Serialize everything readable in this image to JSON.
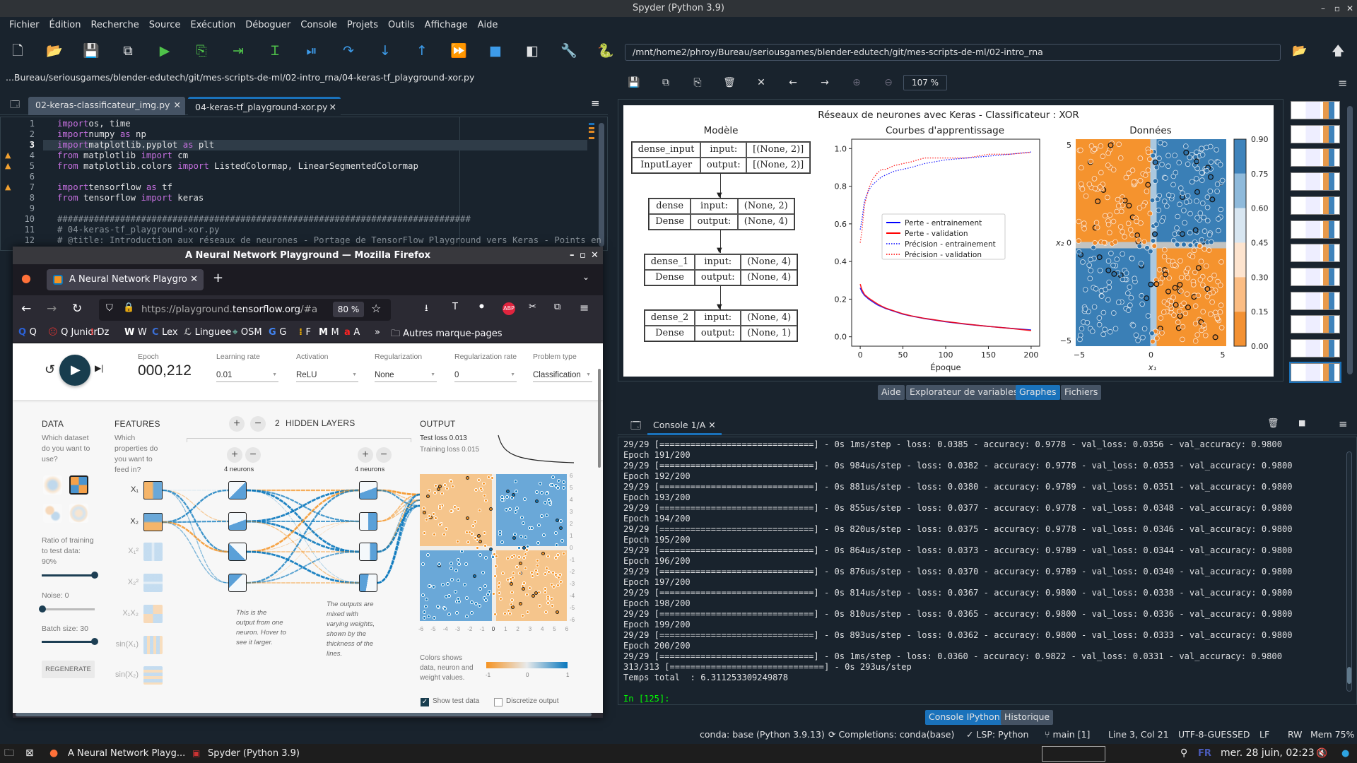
{
  "window": {
    "title": "Spyder (Python 3.9)"
  },
  "menu": [
    "Fichier",
    "Édition",
    "Recherche",
    "Source",
    "Exécution",
    "Déboguer",
    "Console",
    "Projets",
    "Outils",
    "Affichage",
    "Aide"
  ],
  "toolbar": {
    "icons": [
      "new-file-icon",
      "open-folder-icon",
      "save-icon",
      "save-all-icon",
      "run-icon",
      "run-cell-icon",
      "run-cell-advance-icon",
      "run-selection-icon",
      "debug-icon",
      "step-over-icon",
      "step-into-icon",
      "step-out-icon",
      "continue-icon",
      "stop-icon",
      "maximize-pane-icon",
      "preferences-wrench-icon",
      "python-path-icon"
    ],
    "path": "/mnt/home2/phroy/Bureau/seriousgames/blender-edutech/git/mes-scripts-de-ml/02-intro_rna"
  },
  "editor": {
    "breadcrumb": "...Bureau/seriousgames/blender-edutech/git/mes-scripts-de-ml/02-intro_rna/04-keras-tf_playground-xor.py",
    "tabs": [
      {
        "label": "02-keras-classificateur_img.py",
        "active": false
      },
      {
        "label": "04-keras-tf_playground-xor.py",
        "active": true
      }
    ],
    "current_line": 3,
    "warnings": [
      4,
      5,
      7
    ],
    "lines": [
      [
        [
          "kw",
          "import"
        ],
        [
          "",
          "os, time"
        ]
      ],
      [
        [
          "kw",
          "import"
        ],
        [
          "",
          "numpy "
        ],
        [
          "kw",
          "as"
        ],
        [
          "",
          " np"
        ]
      ],
      [
        [
          "kw",
          "import"
        ],
        [
          "",
          "matplotlib.pyplot "
        ],
        [
          "kw",
          "as"
        ],
        [
          "",
          " plt"
        ]
      ],
      [
        [
          "kw",
          "from"
        ],
        [
          "",
          " matplotlib "
        ],
        [
          "kw",
          "import"
        ],
        [
          "",
          " cm"
        ]
      ],
      [
        [
          "kw",
          "from"
        ],
        [
          "",
          " matplotlib.colors "
        ],
        [
          "kw",
          "import"
        ],
        [
          "",
          " ListedColormap, LinearSegmentedColormap"
        ]
      ],
      [],
      [
        [
          "kw",
          "import"
        ],
        [
          "",
          "tensorflow "
        ],
        [
          "kw",
          "as"
        ],
        [
          "",
          " tf"
        ]
      ],
      [
        [
          "kw",
          "from"
        ],
        [
          "",
          " tensorflow "
        ],
        [
          "kw",
          "import"
        ],
        [
          "",
          " keras"
        ]
      ],
      [],
      [
        [
          "cm",
          "###############################################################################"
        ]
      ],
      [
        [
          "cm",
          "# 04-keras-tf_playground-xor.py"
        ]
      ],
      [
        [
          "cm",
          "# @title: Introduction aux réseaux de neurones - Portage de TensorFlow Playground vers Keras - Points en"
        ]
      ]
    ]
  },
  "firefox": {
    "title": "A Neural Network Playground — Mozilla Firefox",
    "tab": "A Neural Network Playgro",
    "url_prefix": "https://playground.",
    "url_domain": "tensorflow.org",
    "url_suffix": "/#a",
    "zoom": "80 %",
    "bookmarks": [
      "Q",
      "Q Junior",
      "Dz",
      "W",
      "Lex",
      "Linguee",
      "OSM",
      "G",
      "F",
      "M",
      "A"
    ],
    "other_bookmarks": "Autres marque-pages"
  },
  "playground": {
    "epoch_label": "Epoch",
    "epoch": "000,212",
    "params": [
      {
        "label": "Learning rate",
        "value": "0.01"
      },
      {
        "label": "Activation",
        "value": "ReLU"
      },
      {
        "label": "Regularization",
        "value": "None"
      },
      {
        "label": "Regularization rate",
        "value": "0"
      },
      {
        "label": "Problem type",
        "value": "Classification"
      }
    ],
    "data": {
      "title": "DATA",
      "question": "Which dataset do you want to use?",
      "selected_dataset": "xor",
      "ratio": "Ratio of training to test data:  90%",
      "ratio_value": 90,
      "noise": "Noise:  0",
      "noise_value": 0,
      "batch": "Batch size:  30",
      "batch_value": 30,
      "regenerate": "REGENERATE"
    },
    "features": {
      "title": "FEATURES",
      "question": "Which properties do you want to feed in?",
      "items": [
        {
          "label": "X₁",
          "active": true
        },
        {
          "label": "X₂",
          "active": true
        },
        {
          "label": "X₁²",
          "active": false
        },
        {
          "label": "X₂²",
          "active": false
        },
        {
          "label": "X₁X₂",
          "active": false
        },
        {
          "label": "sin(X₁)",
          "active": false
        },
        {
          "label": "sin(X₂)",
          "active": false
        }
      ]
    },
    "hidden": {
      "count": "2",
      "label": "HIDDEN LAYERS",
      "layers": [
        {
          "neurons": "4 neurons"
        },
        {
          "neurons": "4 neurons"
        }
      ],
      "note1": "This is the output from one neuron. Hover to see it larger.",
      "note2": "The outputs are mixed with varying weights, shown by the thickness of the lines."
    },
    "output": {
      "title": "OUTPUT",
      "test_loss": "Test loss 0.013",
      "training_loss": "Training loss 0.015",
      "ticks": [
        "6",
        "5",
        "4",
        "3",
        "2",
        "1",
        "0",
        "-1",
        "-2",
        "-3",
        "-4",
        "-5",
        "-6"
      ],
      "xticks": [
        "-6",
        "-5",
        "-4",
        "-3",
        "-2",
        "-1",
        "0",
        "1",
        "2",
        "3",
        "4",
        "5",
        "6"
      ],
      "legend_text": "Colors shows data, neuron and weight values.",
      "legend_ticks": [
        "-1",
        "0",
        "1"
      ],
      "show_test": "Show test data",
      "show_test_checked": true,
      "discretize": "Discretize output",
      "discretize_checked": false,
      "colors": {
        "orange": "#f59322",
        "blue": "#0877bd"
      }
    }
  },
  "plots": {
    "zoom": "107 %",
    "figure_title": "Réseaux de neurones avec Keras - Classificateur : XOR",
    "model": {
      "title": "Modèle",
      "layers": [
        {
          "name": "dense_input",
          "type": "InputLayer",
          "input": "[(None, 2)]",
          "output": "[(None, 2)]"
        },
        {
          "name": "dense",
          "type": "Dense",
          "input": "(None, 2)",
          "output": "(None, 4)"
        },
        {
          "name": "dense_1",
          "type": "Dense",
          "input": "(None, 4)",
          "output": "(None, 4)"
        },
        {
          "name": "dense_2",
          "type": "Dense",
          "input": "(None, 4)",
          "output": "(None, 1)"
        }
      ],
      "input_label": "input:",
      "output_label": "output:"
    },
    "data_panel": {
      "title": "Données",
      "xlabel": "x₁",
      "ylabel": "x₂",
      "xticks": [
        "−5",
        "0",
        "5"
      ],
      "yticks": [
        "5",
        "0",
        "−5"
      ],
      "colorbar": [
        "0.90",
        "0.75",
        "0.60",
        "0.45",
        "0.30",
        "0.15",
        "0.00"
      ],
      "colors": {
        "orange": "#f5932e",
        "blue": "#3a7fb6"
      }
    },
    "thumbnail_count": 12
  },
  "chart_data": {
    "type": "line",
    "title": "Courbes d'apprentissage",
    "xlabel": "Époque",
    "ylabel": "",
    "xlim": [
      -10,
      210
    ],
    "ylim": [
      -0.05,
      1.05
    ],
    "xticks": [
      "0",
      "50",
      "100",
      "150",
      "200"
    ],
    "yticks": [
      "0.0",
      "0.2",
      "0.4",
      "0.6",
      "0.8",
      "1.0"
    ],
    "legend": "center-right",
    "x": [
      0,
      2,
      5,
      10,
      15,
      20,
      25,
      30,
      40,
      50,
      60,
      75,
      100,
      125,
      150,
      175,
      200
    ],
    "series": [
      {
        "name": "Perte - entrainement",
        "color": "#0000ff",
        "style": "solid",
        "values": [
          0.26,
          0.24,
          0.22,
          0.2,
          0.185,
          0.17,
          0.16,
          0.15,
          0.135,
          0.12,
          0.11,
          0.097,
          0.08,
          0.066,
          0.055,
          0.045,
          0.036
        ]
      },
      {
        "name": "Perte - validation",
        "color": "#ff0000",
        "style": "solid",
        "values": [
          0.28,
          0.25,
          0.225,
          0.205,
          0.19,
          0.175,
          0.163,
          0.152,
          0.137,
          0.122,
          0.111,
          0.098,
          0.081,
          0.067,
          0.055,
          0.045,
          0.033
        ]
      },
      {
        "name": "Précision - entrainement",
        "color": "#0000ff",
        "style": "dotted",
        "values": [
          0.57,
          0.62,
          0.72,
          0.78,
          0.81,
          0.83,
          0.85,
          0.86,
          0.88,
          0.89,
          0.9,
          0.92,
          0.94,
          0.95,
          0.96,
          0.97,
          0.982
        ]
      },
      {
        "name": "Précision - validation",
        "color": "#ff0000",
        "style": "dotted",
        "values": [
          0.5,
          0.56,
          0.7,
          0.79,
          0.84,
          0.87,
          0.89,
          0.89,
          0.91,
          0.92,
          0.93,
          0.95,
          0.95,
          0.95,
          0.97,
          0.97,
          0.98
        ]
      }
    ]
  },
  "pane_tabs": [
    {
      "label": "Aide",
      "active": false
    },
    {
      "label": "Explorateur de variables",
      "active": false
    },
    {
      "label": "Graphes",
      "active": true
    },
    {
      "label": "Fichiers",
      "active": false
    }
  ],
  "console": {
    "tab": "Console 1/A",
    "lines": [
      "29/29 [==============================] - 0s 1ms/step - loss: 0.0385 - accuracy: 0.9778 - val_loss: 0.0356 - val_accuracy: 0.9800",
      "Epoch 191/200",
      "29/29 [==============================] - 0s 984us/step - loss: 0.0382 - accuracy: 0.9778 - val_loss: 0.0353 - val_accuracy: 0.9800",
      "Epoch 192/200",
      "29/29 [==============================] - 0s 881us/step - loss: 0.0380 - accuracy: 0.9789 - val_loss: 0.0351 - val_accuracy: 0.9800",
      "Epoch 193/200",
      "29/29 [==============================] - 0s 855us/step - loss: 0.0377 - accuracy: 0.9778 - val_loss: 0.0348 - val_accuracy: 0.9800",
      "Epoch 194/200",
      "29/29 [==============================] - 0s 820us/step - loss: 0.0375 - accuracy: 0.9778 - val_loss: 0.0346 - val_accuracy: 0.9800",
      "Epoch 195/200",
      "29/29 [==============================] - 0s 864us/step - loss: 0.0373 - accuracy: 0.9789 - val_loss: 0.0344 - val_accuracy: 0.9800",
      "Epoch 196/200",
      "29/29 [==============================] - 0s 876us/step - loss: 0.0370 - accuracy: 0.9789 - val_loss: 0.0340 - val_accuracy: 0.9800",
      "Epoch 197/200",
      "29/29 [==============================] - 0s 814us/step - loss: 0.0367 - accuracy: 0.9800 - val_loss: 0.0338 - val_accuracy: 0.9800",
      "Epoch 198/200",
      "29/29 [==============================] - 0s 810us/step - loss: 0.0365 - accuracy: 0.9800 - val_loss: 0.0336 - val_accuracy: 0.9800",
      "Epoch 199/200",
      "29/29 [==============================] - 0s 893us/step - loss: 0.0362 - accuracy: 0.9800 - val_loss: 0.0333 - val_accuracy: 0.9800",
      "Epoch 200/200",
      "29/29 [==============================] - 0s 1ms/step - loss: 0.0360 - accuracy: 0.9822 - val_loss: 0.0331 - val_accuracy: 0.9800",
      "313/313 [==============================] - 0s 293us/step",
      "Temps total  : 6.311253309249878"
    ],
    "prompt": "In [125]:"
  },
  "bottom_tabs": [
    {
      "label": "Console IPython",
      "active": true
    },
    {
      "label": "Historique",
      "active": false
    }
  ],
  "status": {
    "conda": "conda: base (Python 3.9.13)",
    "completions": "Completions: conda(base)",
    "lsp": "LSP: Python",
    "git": "main [1]",
    "cursor": "Line 3, Col 21",
    "encoding": "UTF-8-GUESSED",
    "eol": "LF",
    "mode": "RW",
    "mem": "Mem 75%"
  },
  "taskbar": {
    "items": [
      "A Neural Network Playg...",
      "Spyder (Python 3.9)"
    ],
    "lang": "FR",
    "clock": "mer. 28 juin, 02:23"
  }
}
